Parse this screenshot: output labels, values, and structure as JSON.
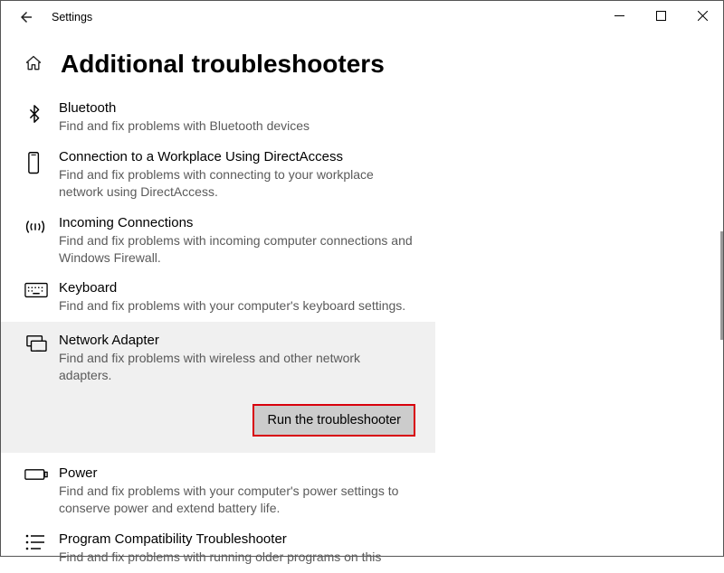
{
  "window": {
    "title": "Settings"
  },
  "page": {
    "heading": "Additional troubleshooters"
  },
  "items": {
    "bluetooth": {
      "title": "Bluetooth",
      "desc": "Find and fix problems with Bluetooth devices"
    },
    "directaccess": {
      "title": "Connection to a Workplace Using DirectAccess",
      "desc": "Find and fix problems with connecting to your workplace network using DirectAccess."
    },
    "incoming": {
      "title": "Incoming Connections",
      "desc": "Find and fix problems with incoming computer connections and Windows Firewall."
    },
    "keyboard": {
      "title": "Keyboard",
      "desc": "Find and fix problems with your computer's keyboard settings."
    },
    "network": {
      "title": "Network Adapter",
      "desc": "Find and fix problems with wireless and other network adapters."
    },
    "power": {
      "title": "Power",
      "desc": "Find and fix problems with your computer's power settings to conserve power and extend battery life."
    },
    "compat": {
      "title": "Program Compatibility Troubleshooter",
      "desc": "Find and fix problems with running older programs on this"
    }
  },
  "button": {
    "run": "Run the troubleshooter"
  }
}
